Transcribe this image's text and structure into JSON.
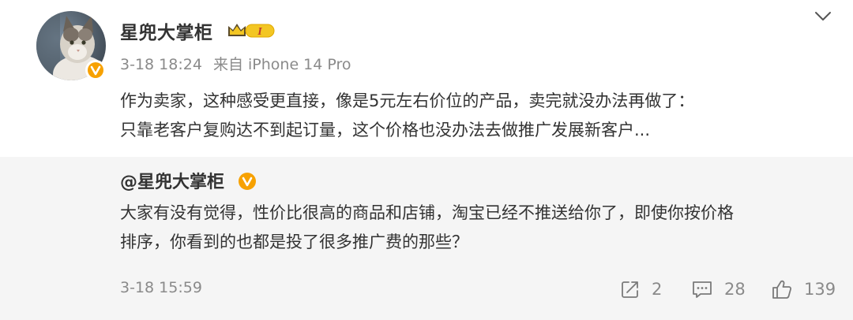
{
  "post": {
    "username": "星兜大掌柜",
    "rank_badge": "I",
    "time": "3-18 18:24",
    "source": "来自 iPhone 14 Pro",
    "content_lines": [
      "作为卖家，这种感受更直接，像是5元左右价位的产品，卖完就没办法再做了：",
      "只靠老客户复购达不到起订量，这个价格也没办法去做推广发展新客户..."
    ]
  },
  "quote": {
    "username": "@星兜大掌柜",
    "content_lines": [
      "大家有没有觉得，性价比很高的商品和店铺，淘宝已经不推送给你了，即使你按价格",
      "排序，你看到的也都是投了很多推广费的那些？"
    ],
    "time": "3-18 15:59",
    "reposts": "2",
    "comments": "28",
    "likes": "139"
  },
  "colors": {
    "verified": "#f7a100",
    "quote_bg": "#f5f5f5",
    "meta_text": "#8a8a8a",
    "badge_gold": "#e8b400"
  },
  "icons": {
    "menu": "chevron-down-icon",
    "verified": "verified-v-icon",
    "rank": "crown-rank-icon",
    "repost": "repost-icon",
    "comment": "comment-icon",
    "like": "thumbs-up-icon"
  }
}
